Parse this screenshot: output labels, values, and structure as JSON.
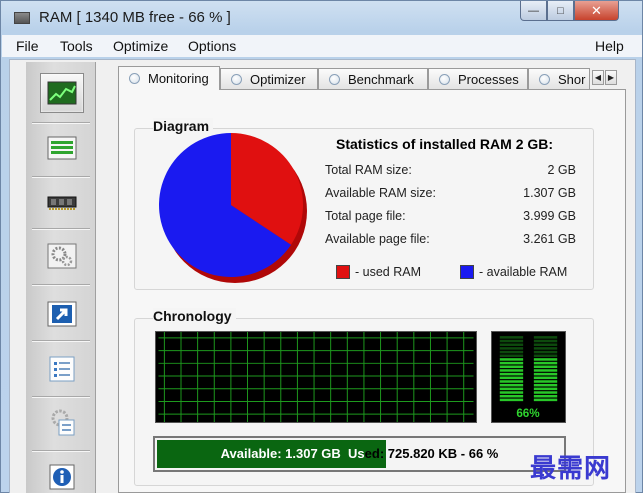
{
  "window": {
    "title": "RAM [ 1340 MB free - 66 % ]",
    "buttons": {
      "minimize": "—",
      "maximize": "□",
      "close": "✕"
    }
  },
  "menu": {
    "items": [
      "File",
      "Tools",
      "Optimize",
      "Options"
    ],
    "help": "Help"
  },
  "sidebar": {
    "items": [
      {
        "name": "monitoring",
        "icon": "chart-icon"
      },
      {
        "name": "list",
        "icon": "list-icon"
      },
      {
        "name": "memory",
        "icon": "memory-chip-icon"
      },
      {
        "name": "settings",
        "icon": "gears-icon"
      },
      {
        "name": "shortcut",
        "icon": "shortcut-arrow-icon"
      },
      {
        "name": "checklist",
        "icon": "checklist-icon"
      },
      {
        "name": "configure",
        "icon": "gear-checklist-icon"
      },
      {
        "name": "info",
        "icon": "info-icon"
      }
    ]
  },
  "tabs": {
    "items": [
      "Monitoring",
      "Optimizer",
      "Benchmark",
      "Processes",
      "Shor"
    ],
    "active": 0
  },
  "diagram": {
    "title": "Diagram",
    "used_fraction": 0.343,
    "colors": {
      "used": "#e01010",
      "available": "#1a1af0"
    }
  },
  "stats": {
    "title": "Statistics of installed RAM 2 GB:",
    "rows": [
      {
        "label": "Total RAM size:",
        "value": "2 GB"
      },
      {
        "label": "Available RAM size:",
        "value": "1.307 GB"
      },
      {
        "label": "Total page file:",
        "value": "3.999 GB"
      },
      {
        "label": "Available page file:",
        "value": "3.261 GB"
      }
    ],
    "legend": {
      "used": "- used RAM",
      "available": "- available RAM"
    }
  },
  "chronology": {
    "title": "Chronology",
    "meter_percent": "66%",
    "meter_level": 0.66
  },
  "status": {
    "available": "Available: 1.307 GB",
    "used_prefix": "Us",
    "used_rest": "ed: 725.820 KB - 66 %",
    "fill_fraction": 0.56
  },
  "watermark": "最需网"
}
